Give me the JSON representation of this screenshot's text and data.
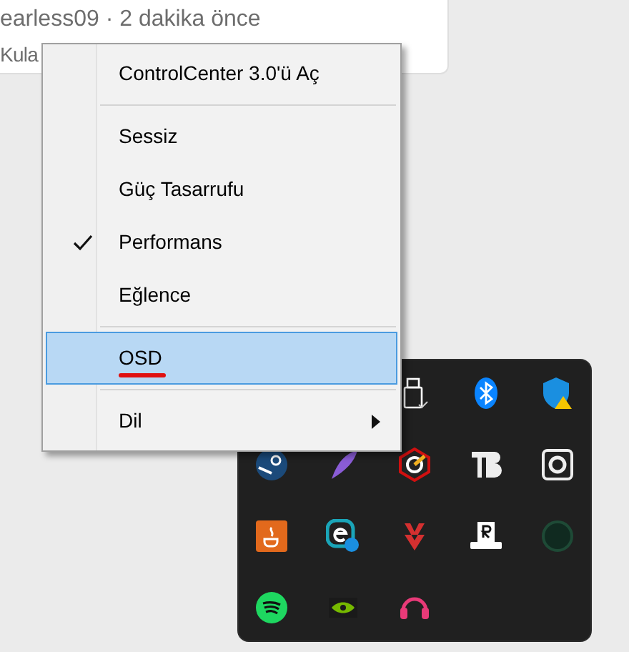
{
  "post": {
    "author_line": "earless09 · 2 dakika önce",
    "text": "Kula"
  },
  "menu": {
    "items": [
      {
        "kind": "item",
        "label": "ControlCenter 3.0'ü Aç",
        "checked": false,
        "selected": false,
        "submenu": false,
        "underlined": false
      },
      {
        "kind": "separator"
      },
      {
        "kind": "item",
        "label": "Sessiz",
        "checked": false,
        "selected": false,
        "submenu": false,
        "underlined": false
      },
      {
        "kind": "item",
        "label": "Güç Tasarrufu",
        "checked": false,
        "selected": false,
        "submenu": false,
        "underlined": false
      },
      {
        "kind": "item",
        "label": "Performans",
        "checked": true,
        "selected": false,
        "submenu": false,
        "underlined": false
      },
      {
        "kind": "item",
        "label": "Eğlence",
        "checked": false,
        "selected": false,
        "submenu": false,
        "underlined": false
      },
      {
        "kind": "separator"
      },
      {
        "kind": "item",
        "label": "OSD",
        "checked": false,
        "selected": true,
        "submenu": false,
        "underlined": true
      },
      {
        "kind": "separator"
      },
      {
        "kind": "item",
        "label": "Dil",
        "checked": false,
        "selected": false,
        "submenu": true,
        "underlined": false
      }
    ]
  }
}
